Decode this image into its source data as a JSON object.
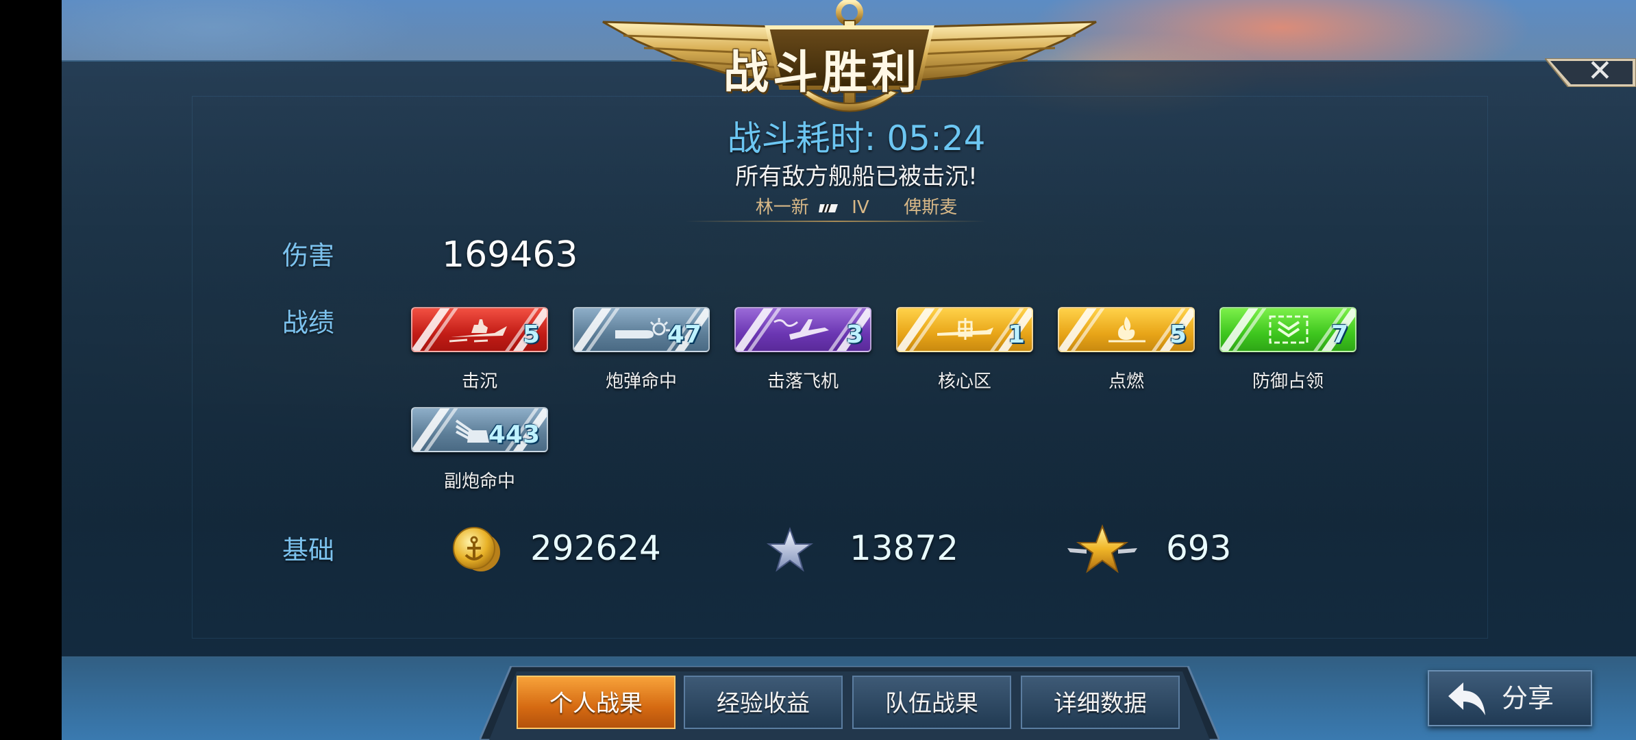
{
  "header": {
    "title": "战斗胜利",
    "battle_time": "战斗耗时: 05:24",
    "result_message": "所有敌方舰船已被击沉!",
    "player_name": "林一新",
    "ship_tier": "IV",
    "ship_name": "俾斯麦",
    "close_symbol": "✕"
  },
  "damage": {
    "label": "伤害",
    "value": "169463"
  },
  "achievements": {
    "label": "战绩",
    "items": [
      {
        "count": "5",
        "label": "击沉",
        "icon": "ship-sinking-icon",
        "color": "#d8261c"
      },
      {
        "count": "47",
        "label": "炮弹命中",
        "icon": "shell-hit-icon",
        "color": "#6a8aa6"
      },
      {
        "count": "3",
        "label": "击落飞机",
        "icon": "plane-shotdown-icon",
        "color": "#7a44c2"
      },
      {
        "count": "1",
        "label": "核心区",
        "icon": "citadel-icon",
        "color": "#eaa81c"
      },
      {
        "count": "5",
        "label": "点燃",
        "icon": "fire-icon",
        "color": "#eaa81c"
      },
      {
        "count": "7",
        "label": "防御占领",
        "icon": "defense-capture-icon",
        "color": "#48cc22"
      },
      {
        "count": "443",
        "label": "副炮命中",
        "icon": "secondary-battery-icon",
        "color": "#6a8aa6"
      }
    ]
  },
  "base": {
    "label": "基础",
    "credits": "292624",
    "experience": "13872",
    "commander_exp": "693"
  },
  "tabs": [
    {
      "label": "个人战果",
      "active": true
    },
    {
      "label": "经验收益",
      "active": false
    },
    {
      "label": "队伍战果",
      "active": false
    },
    {
      "label": "详细数据",
      "active": false
    }
  ],
  "share_label": "分享"
}
